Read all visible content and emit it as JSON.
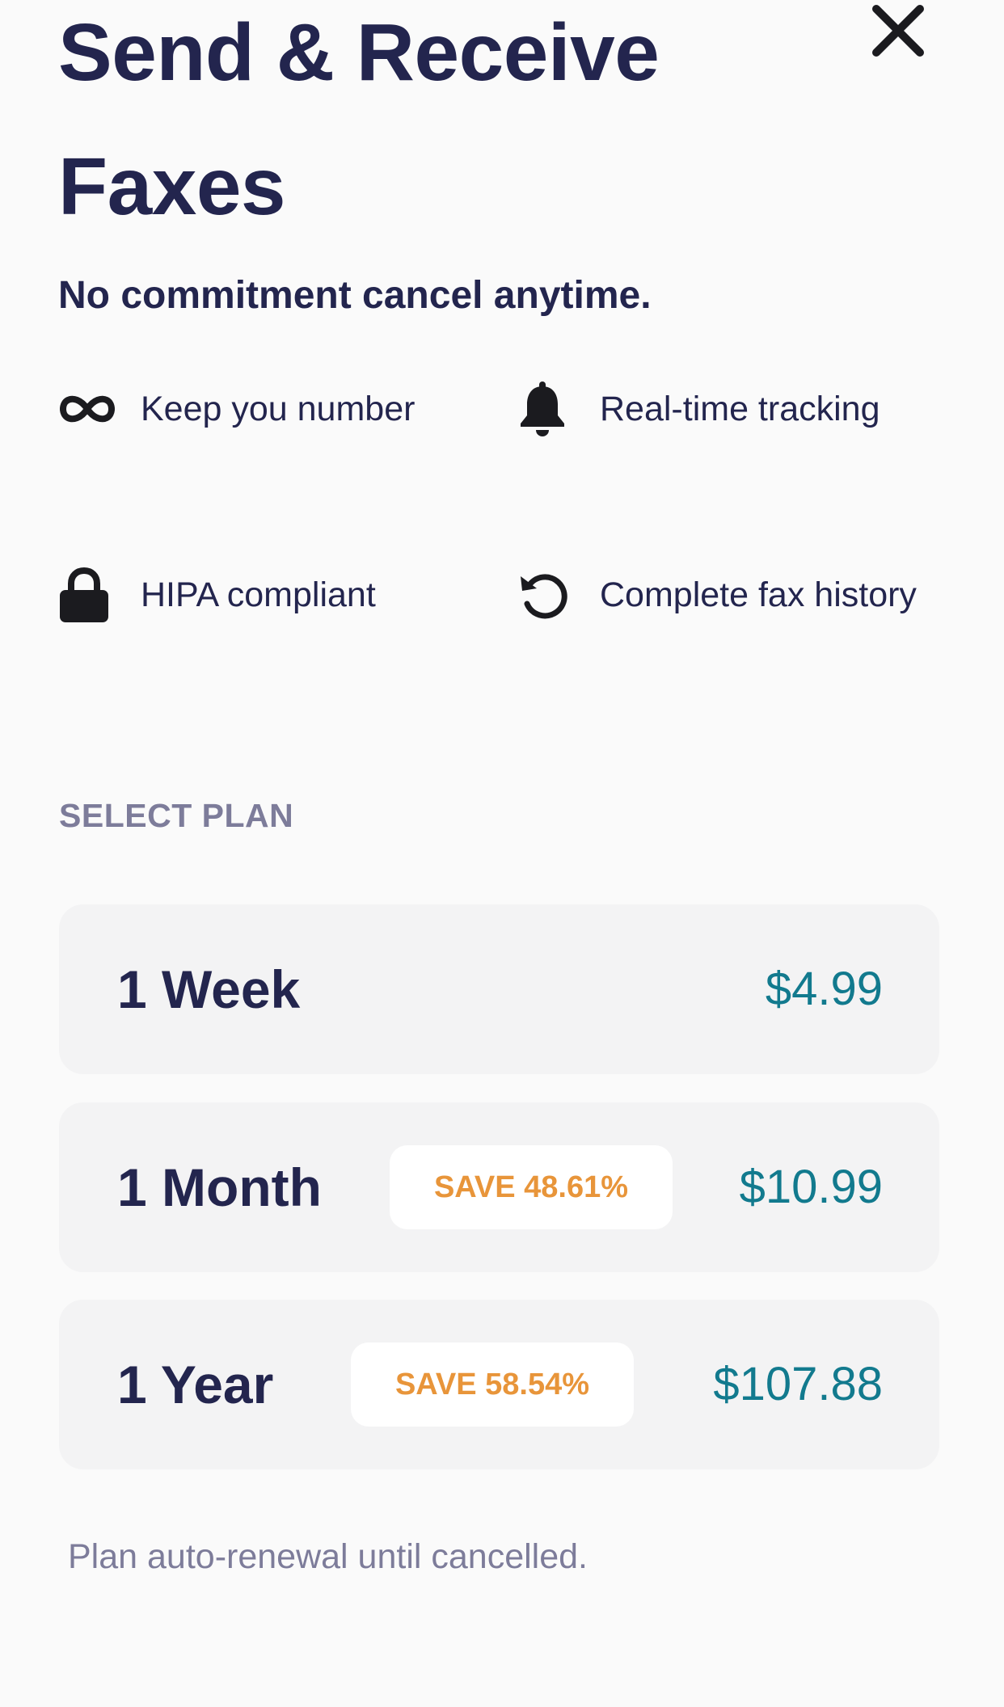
{
  "header": {
    "title": "Send & Receive Faxes",
    "close_icon": "close-icon"
  },
  "subtitle": "No commitment cancel anytime.",
  "features": [
    {
      "icon": "infinity-icon",
      "label": "Keep you number"
    },
    {
      "icon": "bell-icon",
      "label": "Real-time tracking"
    },
    {
      "icon": "lock-icon",
      "label": "HIPA compliant"
    },
    {
      "icon": "history-icon",
      "label": "Complete fax history"
    }
  ],
  "plans_section": {
    "label": "SELECT PLAN",
    "plans": [
      {
        "name": "1 Week",
        "price": "$4.99",
        "badge": ""
      },
      {
        "name": "1 Month",
        "price": "$10.99",
        "badge": "SAVE 48.61%"
      },
      {
        "name": "1 Year",
        "price": "$107.88",
        "badge": "SAVE 58.54%"
      }
    ]
  },
  "footer_note": "Plan auto-renewal until cancelled.",
  "colors": {
    "background": "#fafafa",
    "title": "#23254e",
    "price": "#127a8e",
    "badge_text": "#e8953a",
    "muted": "#7d7c9a",
    "card": "#f3f3f4"
  }
}
